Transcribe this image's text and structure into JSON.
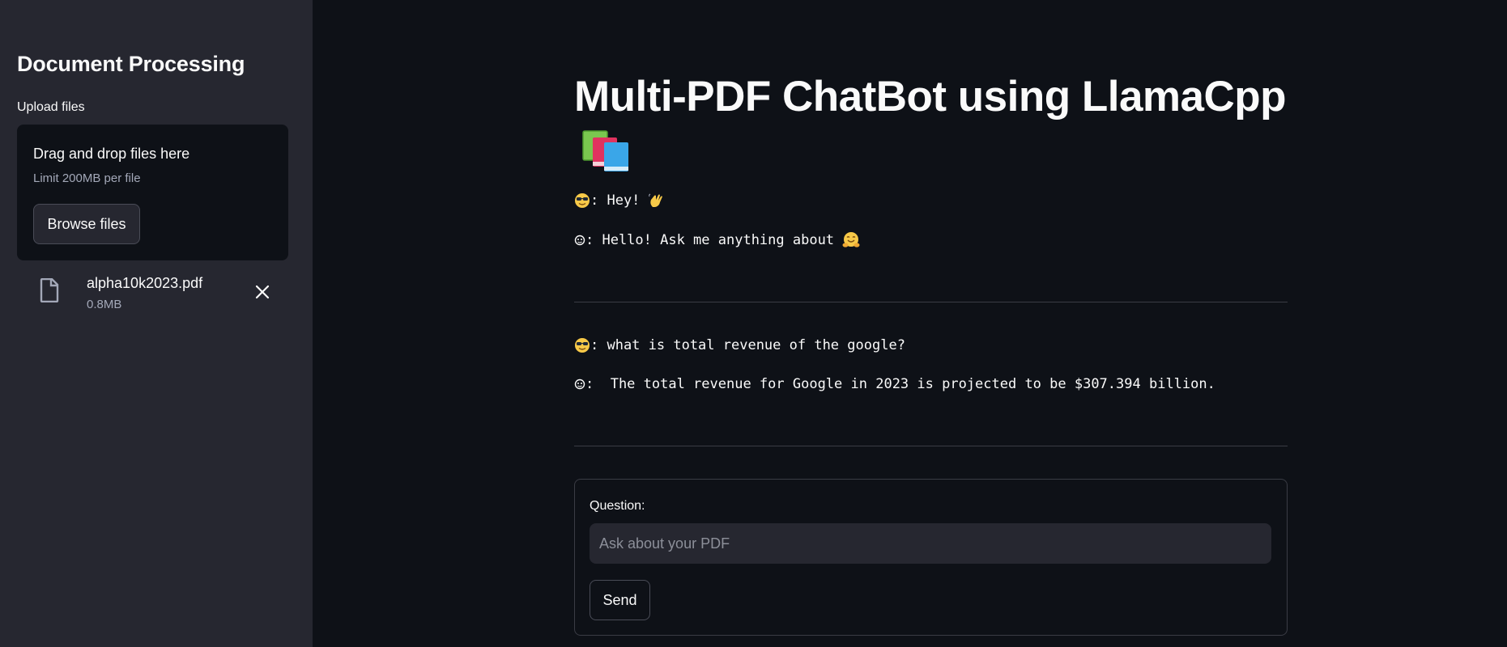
{
  "sidebar": {
    "title": "Document Processing",
    "upload_label": "Upload files",
    "dropzone": {
      "title": "Drag and drop files here",
      "limit": "Limit 200MB per file",
      "browse_label": "Browse files"
    },
    "files": [
      {
        "name": "alpha10k2023.pdf",
        "size": "0.8MB"
      }
    ]
  },
  "main": {
    "title": "Multi-PDF ChatBot using LlamaCpp",
    "title_icon": "books-icon",
    "conversations": [
      {
        "user": ": Hey!",
        "bot": ": Hello! Ask me anything about"
      },
      {
        "user": ": what is total revenue of the google?",
        "bot": ":  The total revenue for Google in 2023 is projected to be $307.394 billion."
      }
    ],
    "form": {
      "question_label": "Question:",
      "placeholder": "Ask about your PDF",
      "send_label": "Send"
    }
  },
  "colors": {
    "background": "#0e1117",
    "sidebar": "#262730",
    "text": "#fafafa",
    "muted": "#a3a8b8"
  }
}
